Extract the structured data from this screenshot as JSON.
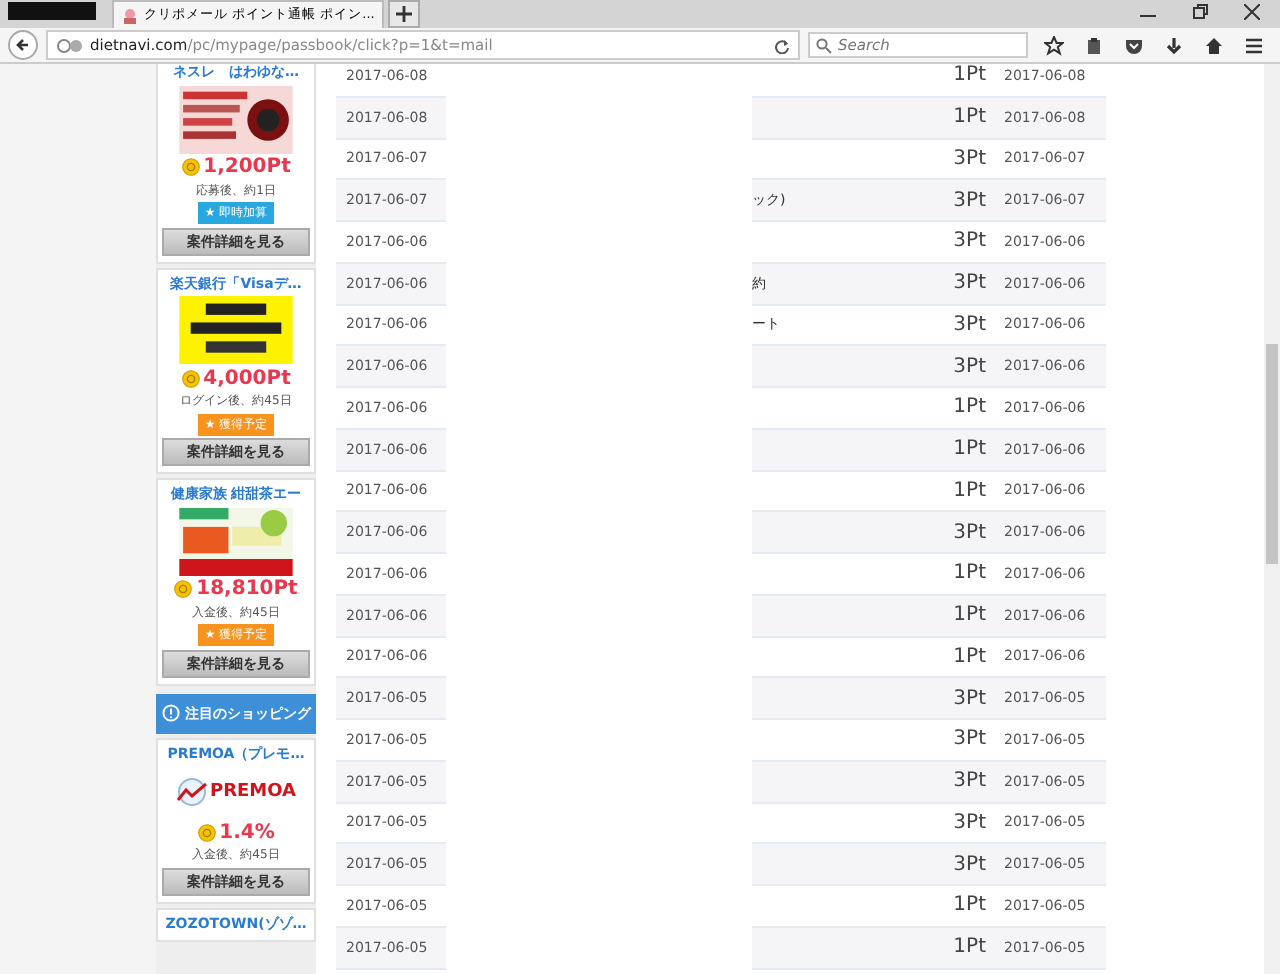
{
  "browser": {
    "tab_title": "クリポメール ポイント通帳 ポイン...",
    "url_host": "dietnavi.com",
    "url_path": "/pc/mypage/passbook/click?p=1&t=mail",
    "search_placeholder": "Search"
  },
  "sidebar": {
    "cards": [
      {
        "title": "ネスレ　はわゆな…",
        "points": "1,200Pt",
        "condition": "応募後、約1日",
        "badge": {
          "text": "★ 即時加算",
          "color": "#29a8e0"
        },
        "button": "案件詳細を見る",
        "kind": "picture"
      },
      {
        "title": "楽天銀行「Visaデ…",
        "points": "4,000Pt",
        "condition": "ログイン後、約45日",
        "badge": {
          "text": "★ 獲得予定",
          "color": "#f7931e"
        },
        "button": "案件詳細を見る",
        "kind": "picture"
      },
      {
        "title": "健康家族 紺甜茶エー",
        "points": "18,810Pt",
        "condition": "入金後、約45日",
        "badge": {
          "text": "★ 獲得予定",
          "color": "#f7931e"
        },
        "button": "案件詳細を見る",
        "kind": "picture"
      }
    ],
    "section_header": "注目のショッピング",
    "shop_cards": [
      {
        "title": "PREMOA（プレモ…",
        "logo": "PREMOA",
        "rate": "1.4%",
        "condition": "入金後、約45日",
        "button": "案件詳細を見る"
      }
    ],
    "next_title": "ZOZOTOWN(ゾゾ…"
  },
  "table": {
    "rows": [
      {
        "date": "2017-06-08",
        "points": "1Pt",
        "date_2": "2017-06-08"
      },
      {
        "date": "2017-06-08",
        "points": "1Pt",
        "date_2": "2017-06-08"
      },
      {
        "date": "2017-06-07",
        "points": "3Pt",
        "date_2": "2017-06-07"
      },
      {
        "date": "2017-06-07",
        "fragment": "ック)",
        "points": "3Pt",
        "date_2": "2017-06-07"
      },
      {
        "date": "2017-06-06",
        "points": "3Pt",
        "date_2": "2017-06-06"
      },
      {
        "date": "2017-06-06",
        "fragment": "約",
        "points": "3Pt",
        "date_2": "2017-06-06"
      },
      {
        "date": "2017-06-06",
        "fragment": "ート",
        "points": "3Pt",
        "date_2": "2017-06-06"
      },
      {
        "date": "2017-06-06",
        "points": "3Pt",
        "date_2": "2017-06-06"
      },
      {
        "date": "2017-06-06",
        "points": "1Pt",
        "date_2": "2017-06-06"
      },
      {
        "date": "2017-06-06",
        "points": "1Pt",
        "date_2": "2017-06-06"
      },
      {
        "date": "2017-06-06",
        "points": "1Pt",
        "date_2": "2017-06-06"
      },
      {
        "date": "2017-06-06",
        "points": "3Pt",
        "date_2": "2017-06-06"
      },
      {
        "date": "2017-06-06",
        "points": "1Pt",
        "date_2": "2017-06-06"
      },
      {
        "date": "2017-06-06",
        "points": "1Pt",
        "date_2": "2017-06-06"
      },
      {
        "date": "2017-06-06",
        "points": "1Pt",
        "date_2": "2017-06-06"
      },
      {
        "date": "2017-06-05",
        "points": "3Pt",
        "date_2": "2017-06-05"
      },
      {
        "date": "2017-06-05",
        "points": "3Pt",
        "date_2": "2017-06-05"
      },
      {
        "date": "2017-06-05",
        "points": "3Pt",
        "date_2": "2017-06-05"
      },
      {
        "date": "2017-06-05",
        "points": "3Pt",
        "date_2": "2017-06-05"
      },
      {
        "date": "2017-06-05",
        "points": "3Pt",
        "date_2": "2017-06-05"
      },
      {
        "date": "2017-06-05",
        "points": "1Pt",
        "date_2": "2017-06-05"
      },
      {
        "date": "2017-06-05",
        "points": "1Pt",
        "date_2": "2017-06-05"
      }
    ]
  }
}
